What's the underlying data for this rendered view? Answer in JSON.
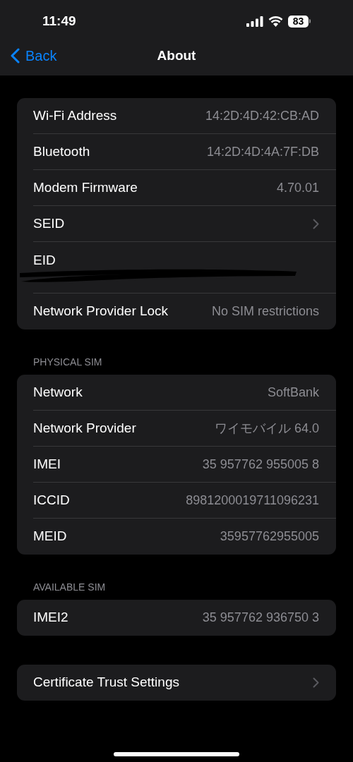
{
  "status_bar": {
    "time": "11:49",
    "battery": "83"
  },
  "nav": {
    "back": "Back",
    "title": "About"
  },
  "sections": [
    {
      "rows": [
        {
          "kind": "value",
          "label": "Wi-Fi Address",
          "value": "14:2D:4D:42:CB:AD"
        },
        {
          "kind": "value",
          "label": "Bluetooth",
          "value": "14:2D:4D:4A:7F:DB"
        },
        {
          "kind": "value",
          "label": "Modem Firmware",
          "value": "4.70.01"
        },
        {
          "kind": "chevron",
          "label": "SEID"
        },
        {
          "kind": "redacted",
          "label": "EID"
        },
        {
          "kind": "value",
          "label": "Network Provider Lock",
          "value": "No SIM restrictions"
        }
      ]
    },
    {
      "header": "PHYSICAL SIM",
      "rows": [
        {
          "kind": "value",
          "label": "Network",
          "value": "SoftBank"
        },
        {
          "kind": "value",
          "label": "Network Provider",
          "value": "ワイモバイル 64.0"
        },
        {
          "kind": "value",
          "label": "IMEI",
          "value": "35 957762 955005 8"
        },
        {
          "kind": "value",
          "label": "ICCID",
          "value": "8981200019711096231"
        },
        {
          "kind": "value",
          "label": "MEID",
          "value": "35957762955005"
        }
      ]
    },
    {
      "header": "AVAILABLE SIM",
      "rows": [
        {
          "kind": "value",
          "label": "IMEI2",
          "value": "35 957762 936750 3"
        }
      ]
    },
    {
      "rows": [
        {
          "kind": "chevron",
          "label": "Certificate Trust Settings"
        }
      ]
    }
  ]
}
